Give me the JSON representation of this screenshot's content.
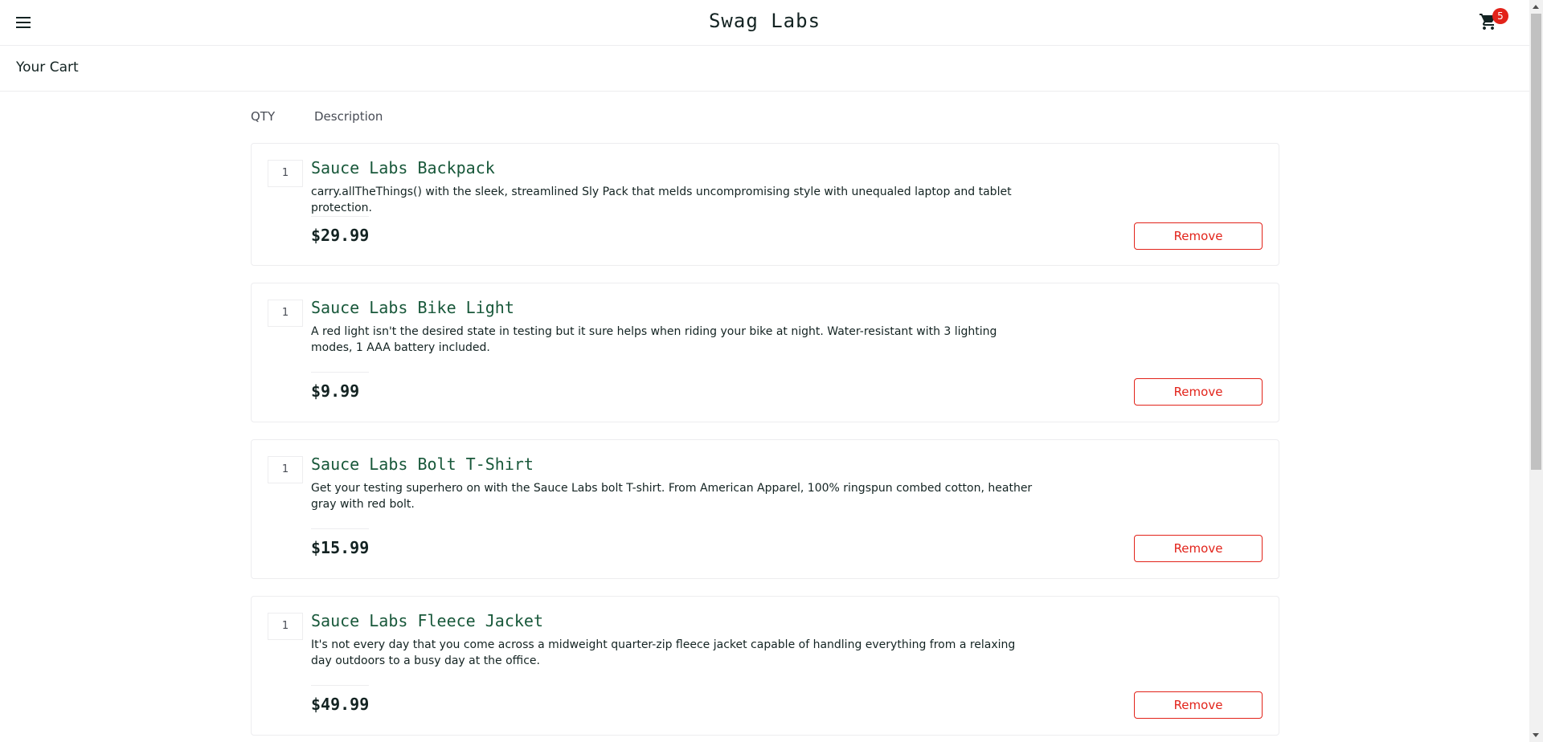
{
  "header": {
    "app_title": "Swag Labs",
    "cart_count": "5"
  },
  "secondary_header": {
    "title": "Your Cart"
  },
  "cart": {
    "qty_label": "QTY",
    "description_label": "Description",
    "items": [
      {
        "quantity": "1",
        "name": "Sauce Labs Backpack",
        "description": "carry.allTheThings() with the sleek, streamlined Sly Pack that melds uncompromising style with unequaled laptop and tablet protection.",
        "price": "$29.99",
        "remove_label": "Remove"
      },
      {
        "quantity": "1",
        "name": "Sauce Labs Bike Light",
        "description": "A red light isn't the desired state in testing but it sure helps when riding your bike at night. Water-resistant with 3 lighting modes, 1 AAA battery included.",
        "price": "$9.99",
        "remove_label": "Remove"
      },
      {
        "quantity": "1",
        "name": "Sauce Labs Bolt T-Shirt",
        "description": "Get your testing superhero on with the Sauce Labs bolt T-shirt. From American Apparel, 100% ringspun combed cotton, heather gray with red bolt.",
        "price": "$15.99",
        "remove_label": "Remove"
      },
      {
        "quantity": "1",
        "name": "Sauce Labs Fleece Jacket",
        "description": "It's not every day that you come across a midweight quarter-zip fleece jacket capable of handling everything from a relaxing day outdoors to a busy day at the office.",
        "price": "$49.99",
        "remove_label": "Remove"
      }
    ]
  },
  "colors": {
    "accent_red": "#e2231a",
    "item_name_green": "#18583a",
    "text_dark": "#132322",
    "border": "#ededef"
  },
  "icons": {
    "menu": "hamburger-menu-icon",
    "cart": "shopping-cart-icon"
  }
}
